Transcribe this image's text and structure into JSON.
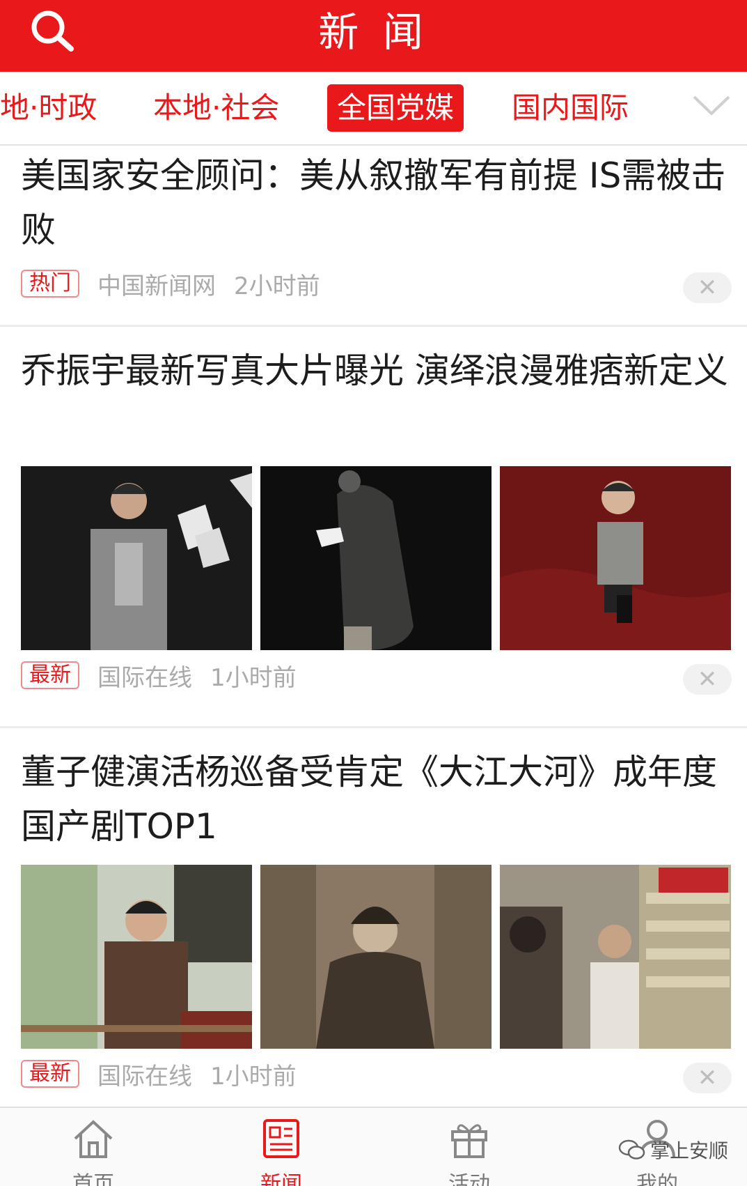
{
  "header": {
    "title": "新 闻"
  },
  "tabs": [
    {
      "label": "本地·时政",
      "active": false
    },
    {
      "label": "本地·社会",
      "active": false
    },
    {
      "label": "全国党媒",
      "active": true
    },
    {
      "label": "国内国际",
      "active": false
    }
  ],
  "articles": [
    {
      "title": "美国家安全顾问：美从叙撤军有前提 IS需被击败",
      "badge": "热门",
      "source": "中国新闻网",
      "time": "2小时前",
      "close": "✕"
    },
    {
      "title": "乔振宇最新写真大片曝光 演绎浪漫雅痞新定义",
      "badge": "最新",
      "source": "国际在线",
      "time": "1小时前",
      "close": "✕"
    },
    {
      "title": "董子健演活杨巡备受肯定《大江大河》成年度国产剧TOP1",
      "badge": "最新",
      "source": "国际在线",
      "time": "1小时前",
      "close": "✕"
    }
  ],
  "bottom_nav": [
    {
      "label": "首页",
      "icon": "home-icon",
      "active": false
    },
    {
      "label": "新闻",
      "icon": "news-icon",
      "active": true
    },
    {
      "label": "活动",
      "icon": "gift-icon",
      "active": false
    },
    {
      "label": "我的",
      "icon": "user-icon",
      "active": false
    }
  ],
  "watermark": "掌上安顺",
  "colors": {
    "accent": "#e8181b",
    "muted": "#aaaaaa"
  }
}
